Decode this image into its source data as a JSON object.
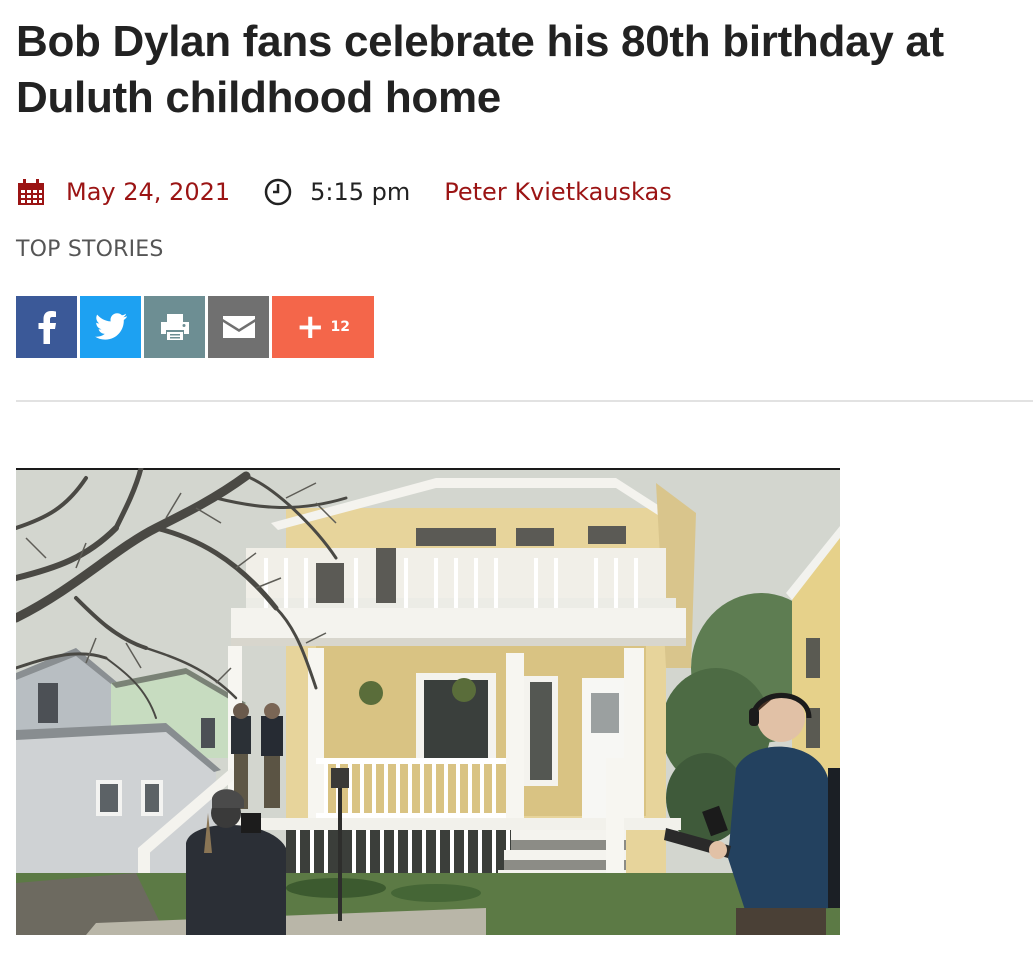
{
  "article": {
    "title": "Bob Dylan fans celebrate his 80th birthday at Duluth childhood home",
    "date": "May 24, 2021",
    "time": "5:15 pm",
    "author": "Peter Kvietkauskas",
    "category": "TOP STORIES"
  },
  "share": {
    "icons": [
      "facebook-icon",
      "twitter-icon",
      "print-icon",
      "email-icon",
      "plus-icon"
    ],
    "more_count": "12"
  },
  "colors": {
    "accent": "#9b1414",
    "facebook": "#3b5998",
    "twitter": "#1da1f2",
    "print": "#6d8e93",
    "email": "#707070",
    "more": "#f4664a"
  }
}
